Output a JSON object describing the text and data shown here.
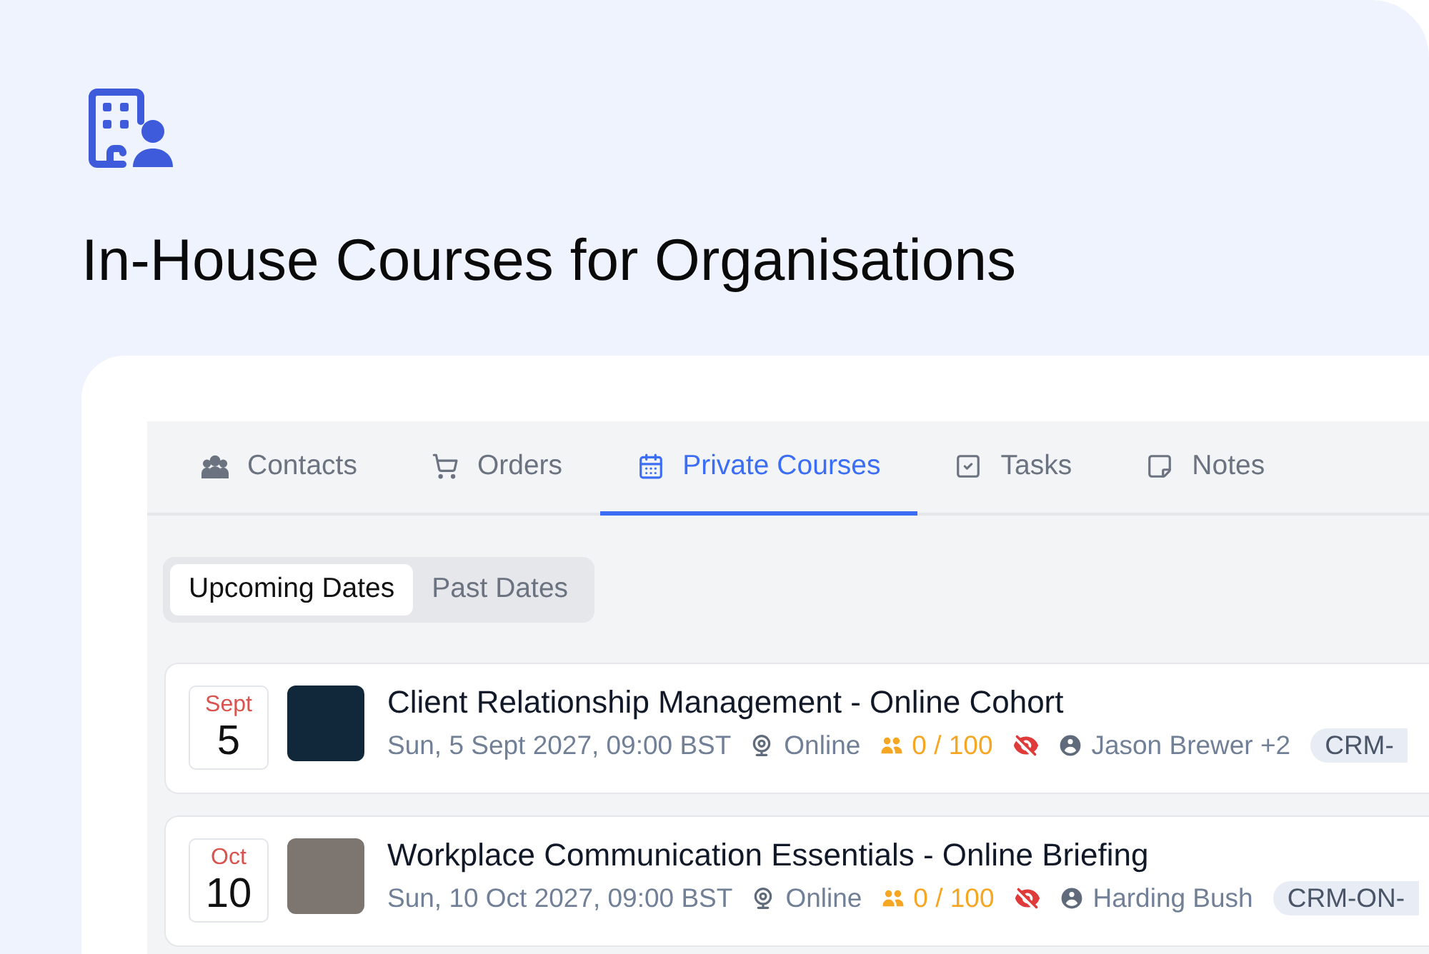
{
  "header": {
    "title": "In-House Courses for Organisations"
  },
  "tabs": [
    {
      "label": "Contacts",
      "selected": false
    },
    {
      "label": "Orders",
      "selected": false
    },
    {
      "label": "Private Courses",
      "selected": true
    },
    {
      "label": "Tasks",
      "selected": false
    },
    {
      "label": "Notes",
      "selected": false
    }
  ],
  "date_filter": [
    {
      "label": "Upcoming Dates",
      "selected": true
    },
    {
      "label": "Past Dates",
      "selected": false
    }
  ],
  "courses": [
    {
      "month": "Sept",
      "day": "5",
      "title": "Client Relationship Management - Online Cohort",
      "datetime": "Sun, 5 Sept 2027, 09:00 BST",
      "location": "Online",
      "attendance": "0 / 100",
      "visible": false,
      "trainer": "Jason Brewer +2",
      "code": "CRM-"
    },
    {
      "month": "Oct",
      "day": "10",
      "title": "Workplace Communication Essentials - Online Briefing",
      "datetime": "Sun, 10 Oct 2027, 09:00 BST",
      "location": "Online",
      "attendance": "0 / 100",
      "visible": false,
      "trainer": "Harding Bush",
      "code": "CRM-ON-"
    }
  ]
}
